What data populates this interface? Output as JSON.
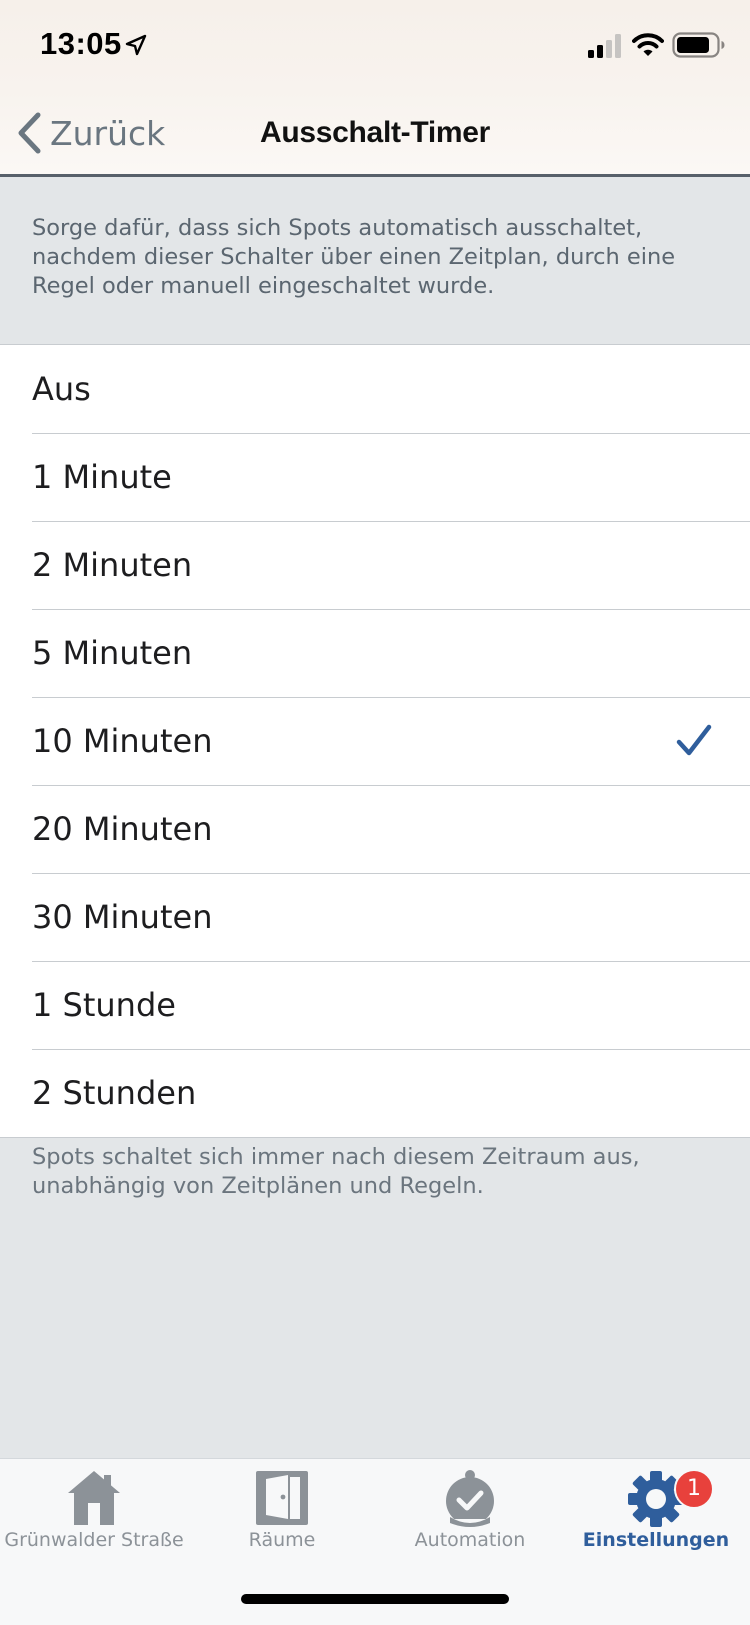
{
  "status_bar": {
    "time": "13:05"
  },
  "nav": {
    "back_label": "Zurück",
    "title": "Ausschalt-Timer"
  },
  "header_description": "Sorge dafür, dass sich Spots automatisch ausschaltet, nachdem dieser Schalter über einen Zeitplan, durch eine Regel oder manuell eingeschaltet wurde.",
  "options": [
    {
      "label": "Aus",
      "selected": false
    },
    {
      "label": "1 Minute",
      "selected": false
    },
    {
      "label": "2 Minuten",
      "selected": false
    },
    {
      "label": "5 Minuten",
      "selected": false
    },
    {
      "label": "10 Minuten",
      "selected": true
    },
    {
      "label": "20 Minuten",
      "selected": false
    },
    {
      "label": "30 Minuten",
      "selected": false
    },
    {
      "label": "1 Stunde",
      "selected": false
    },
    {
      "label": "2 Stunden",
      "selected": false
    }
  ],
  "footer_note": "Spots schaltet sich immer nach diesem Zeitraum aus, unabhängig von Zeitplänen und Regeln.",
  "tabs": [
    {
      "label": "Grünwalder Straße",
      "icon": "house-icon",
      "active": false
    },
    {
      "label": "Räume",
      "icon": "door-icon",
      "active": false
    },
    {
      "label": "Automation",
      "icon": "alarm-clock-icon",
      "active": false
    },
    {
      "label": "Einstellungen",
      "icon": "gear-icon",
      "active": true,
      "badge": "1"
    }
  ],
  "colors": {
    "accent": "#2f5e9c",
    "badge": "#e8413c",
    "inactive_tab": "#8c9298"
  }
}
